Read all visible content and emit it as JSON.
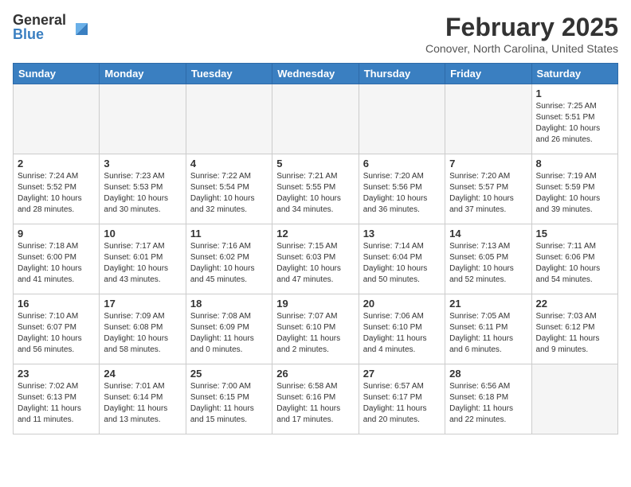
{
  "header": {
    "logo_general": "General",
    "logo_blue": "Blue",
    "month_title": "February 2025",
    "location": "Conover, North Carolina, United States"
  },
  "calendar": {
    "days_of_week": [
      "Sunday",
      "Monday",
      "Tuesday",
      "Wednesday",
      "Thursday",
      "Friday",
      "Saturday"
    ],
    "weeks": [
      [
        {
          "day": "",
          "info": ""
        },
        {
          "day": "",
          "info": ""
        },
        {
          "day": "",
          "info": ""
        },
        {
          "day": "",
          "info": ""
        },
        {
          "day": "",
          "info": ""
        },
        {
          "day": "",
          "info": ""
        },
        {
          "day": "1",
          "info": "Sunrise: 7:25 AM\nSunset: 5:51 PM\nDaylight: 10 hours and 26 minutes."
        }
      ],
      [
        {
          "day": "2",
          "info": "Sunrise: 7:24 AM\nSunset: 5:52 PM\nDaylight: 10 hours and 28 minutes."
        },
        {
          "day": "3",
          "info": "Sunrise: 7:23 AM\nSunset: 5:53 PM\nDaylight: 10 hours and 30 minutes."
        },
        {
          "day": "4",
          "info": "Sunrise: 7:22 AM\nSunset: 5:54 PM\nDaylight: 10 hours and 32 minutes."
        },
        {
          "day": "5",
          "info": "Sunrise: 7:21 AM\nSunset: 5:55 PM\nDaylight: 10 hours and 34 minutes."
        },
        {
          "day": "6",
          "info": "Sunrise: 7:20 AM\nSunset: 5:56 PM\nDaylight: 10 hours and 36 minutes."
        },
        {
          "day": "7",
          "info": "Sunrise: 7:20 AM\nSunset: 5:57 PM\nDaylight: 10 hours and 37 minutes."
        },
        {
          "day": "8",
          "info": "Sunrise: 7:19 AM\nSunset: 5:59 PM\nDaylight: 10 hours and 39 minutes."
        }
      ],
      [
        {
          "day": "9",
          "info": "Sunrise: 7:18 AM\nSunset: 6:00 PM\nDaylight: 10 hours and 41 minutes."
        },
        {
          "day": "10",
          "info": "Sunrise: 7:17 AM\nSunset: 6:01 PM\nDaylight: 10 hours and 43 minutes."
        },
        {
          "day": "11",
          "info": "Sunrise: 7:16 AM\nSunset: 6:02 PM\nDaylight: 10 hours and 45 minutes."
        },
        {
          "day": "12",
          "info": "Sunrise: 7:15 AM\nSunset: 6:03 PM\nDaylight: 10 hours and 47 minutes."
        },
        {
          "day": "13",
          "info": "Sunrise: 7:14 AM\nSunset: 6:04 PM\nDaylight: 10 hours and 50 minutes."
        },
        {
          "day": "14",
          "info": "Sunrise: 7:13 AM\nSunset: 6:05 PM\nDaylight: 10 hours and 52 minutes."
        },
        {
          "day": "15",
          "info": "Sunrise: 7:11 AM\nSunset: 6:06 PM\nDaylight: 10 hours and 54 minutes."
        }
      ],
      [
        {
          "day": "16",
          "info": "Sunrise: 7:10 AM\nSunset: 6:07 PM\nDaylight: 10 hours and 56 minutes."
        },
        {
          "day": "17",
          "info": "Sunrise: 7:09 AM\nSunset: 6:08 PM\nDaylight: 10 hours and 58 minutes."
        },
        {
          "day": "18",
          "info": "Sunrise: 7:08 AM\nSunset: 6:09 PM\nDaylight: 11 hours and 0 minutes."
        },
        {
          "day": "19",
          "info": "Sunrise: 7:07 AM\nSunset: 6:10 PM\nDaylight: 11 hours and 2 minutes."
        },
        {
          "day": "20",
          "info": "Sunrise: 7:06 AM\nSunset: 6:10 PM\nDaylight: 11 hours and 4 minutes."
        },
        {
          "day": "21",
          "info": "Sunrise: 7:05 AM\nSunset: 6:11 PM\nDaylight: 11 hours and 6 minutes."
        },
        {
          "day": "22",
          "info": "Sunrise: 7:03 AM\nSunset: 6:12 PM\nDaylight: 11 hours and 9 minutes."
        }
      ],
      [
        {
          "day": "23",
          "info": "Sunrise: 7:02 AM\nSunset: 6:13 PM\nDaylight: 11 hours and 11 minutes."
        },
        {
          "day": "24",
          "info": "Sunrise: 7:01 AM\nSunset: 6:14 PM\nDaylight: 11 hours and 13 minutes."
        },
        {
          "day": "25",
          "info": "Sunrise: 7:00 AM\nSunset: 6:15 PM\nDaylight: 11 hours and 15 minutes."
        },
        {
          "day": "26",
          "info": "Sunrise: 6:58 AM\nSunset: 6:16 PM\nDaylight: 11 hours and 17 minutes."
        },
        {
          "day": "27",
          "info": "Sunrise: 6:57 AM\nSunset: 6:17 PM\nDaylight: 11 hours and 20 minutes."
        },
        {
          "day": "28",
          "info": "Sunrise: 6:56 AM\nSunset: 6:18 PM\nDaylight: 11 hours and 22 minutes."
        },
        {
          "day": "",
          "info": ""
        }
      ]
    ]
  }
}
